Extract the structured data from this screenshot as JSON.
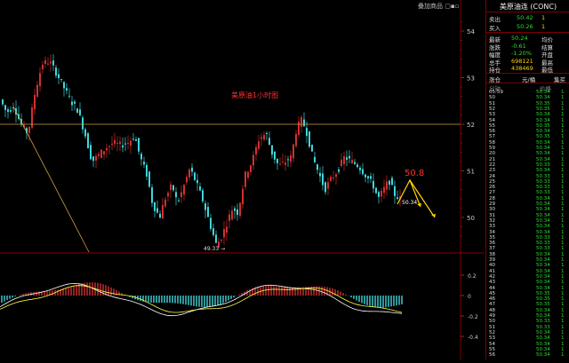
{
  "toolbar": {
    "overlay_label": "叠加商品"
  },
  "chart_title": "美原油1小时图",
  "price_axis": {
    "ticks": [
      "54",
      "53",
      "52",
      "51",
      "50"
    ]
  },
  "osc_axis": {
    "ticks": [
      "0.2",
      "0",
      "-0.2",
      "-0.4"
    ]
  },
  "annotations": {
    "low_label": "49.33",
    "peak_label": "50.8",
    "last_price_label": "50.34"
  },
  "colors": {
    "up": "#d23030",
    "down": "#3fd6dc",
    "ma": "#ffffff",
    "signal": "#ffff44",
    "hline": "#d0a040",
    "accent_red": "#ff3030",
    "green": "#2adf2a",
    "yellow": "#ffd400"
  },
  "quote": {
    "title": "美原油连 (CONC)",
    "sell": {
      "label": "卖出",
      "price": "50.42",
      "vol": "1"
    },
    "buy": {
      "label": "买入",
      "price": "50.26",
      "vol": "1"
    },
    "stats": [
      {
        "l": "最新",
        "v": "50.24",
        "l2": "均价"
      },
      {
        "l": "涨跌",
        "v": "-0.61",
        "l2": "结算"
      },
      {
        "l": "幅度",
        "v": "-1.20%",
        "l2": "开盘"
      },
      {
        "l": "总手",
        "v": "698121",
        "l2": "最高"
      },
      {
        "l": "持仓",
        "v": "438469",
        "l2": "最低"
      }
    ]
  },
  "ticks_header": {
    "first": "涨仓",
    "mid": "元/桶",
    "last": "集买"
  },
  "ticks_subheader": {
    "first": "分钟",
    "last": "价格"
  },
  "ticks": [
    {
      "t": "05:59",
      "p": "50.34"
    },
    {
      "t": "50",
      "p": "50.34"
    },
    {
      "t": "51",
      "p": "50.35"
    },
    {
      "t": "52",
      "p": "50.35"
    },
    {
      "t": "53",
      "p": "50.34"
    },
    {
      "t": "54",
      "p": "50.34"
    },
    {
      "t": "55",
      "p": "50.35"
    },
    {
      "t": "56",
      "p": "50.34"
    },
    {
      "t": "57",
      "p": "50.35"
    },
    {
      "t": "58",
      "p": "50.34"
    },
    {
      "t": "59",
      "p": "50.34"
    },
    {
      "t": "20",
      "p": "50.34"
    },
    {
      "t": "21",
      "p": "50.34"
    },
    {
      "t": "22",
      "p": "50.33"
    },
    {
      "t": "23",
      "p": "50.34"
    },
    {
      "t": "24",
      "p": "50.33"
    },
    {
      "t": "25",
      "p": "50.33"
    },
    {
      "t": "26",
      "p": "50.33"
    },
    {
      "t": "27",
      "p": "50.33"
    },
    {
      "t": "28",
      "p": "50.34"
    },
    {
      "t": "29",
      "p": "50.34"
    },
    {
      "t": "30",
      "p": "50.34"
    },
    {
      "t": "31",
      "p": "50.34"
    },
    {
      "t": "32",
      "p": "50.34"
    },
    {
      "t": "33",
      "p": "50.34"
    },
    {
      "t": "34",
      "p": "50.34"
    },
    {
      "t": "35",
      "p": "50.33"
    },
    {
      "t": "36",
      "p": "50.33"
    },
    {
      "t": "37",
      "p": "50.33"
    },
    {
      "t": "38",
      "p": "50.34"
    },
    {
      "t": "39",
      "p": "50.34"
    },
    {
      "t": "40",
      "p": "50.34"
    },
    {
      "t": "41",
      "p": "50.34"
    },
    {
      "t": "42",
      "p": "50.34"
    },
    {
      "t": "43",
      "p": "50.34"
    },
    {
      "t": "44",
      "p": "50.34"
    },
    {
      "t": "45",
      "p": "50.35"
    },
    {
      "t": "46",
      "p": "50.35"
    },
    {
      "t": "47",
      "p": "50.35"
    },
    {
      "t": "48",
      "p": "50.34"
    },
    {
      "t": "49",
      "p": "50.34"
    },
    {
      "t": "50",
      "p": "50.33"
    },
    {
      "t": "51",
      "p": "50.33"
    },
    {
      "t": "52",
      "p": "50.34"
    },
    {
      "t": "53",
      "p": "50.34"
    },
    {
      "t": "54",
      "p": "50.34"
    },
    {
      "t": "55",
      "p": "50.34"
    },
    {
      "t": "56",
      "p": "50.34"
    }
  ]
}
